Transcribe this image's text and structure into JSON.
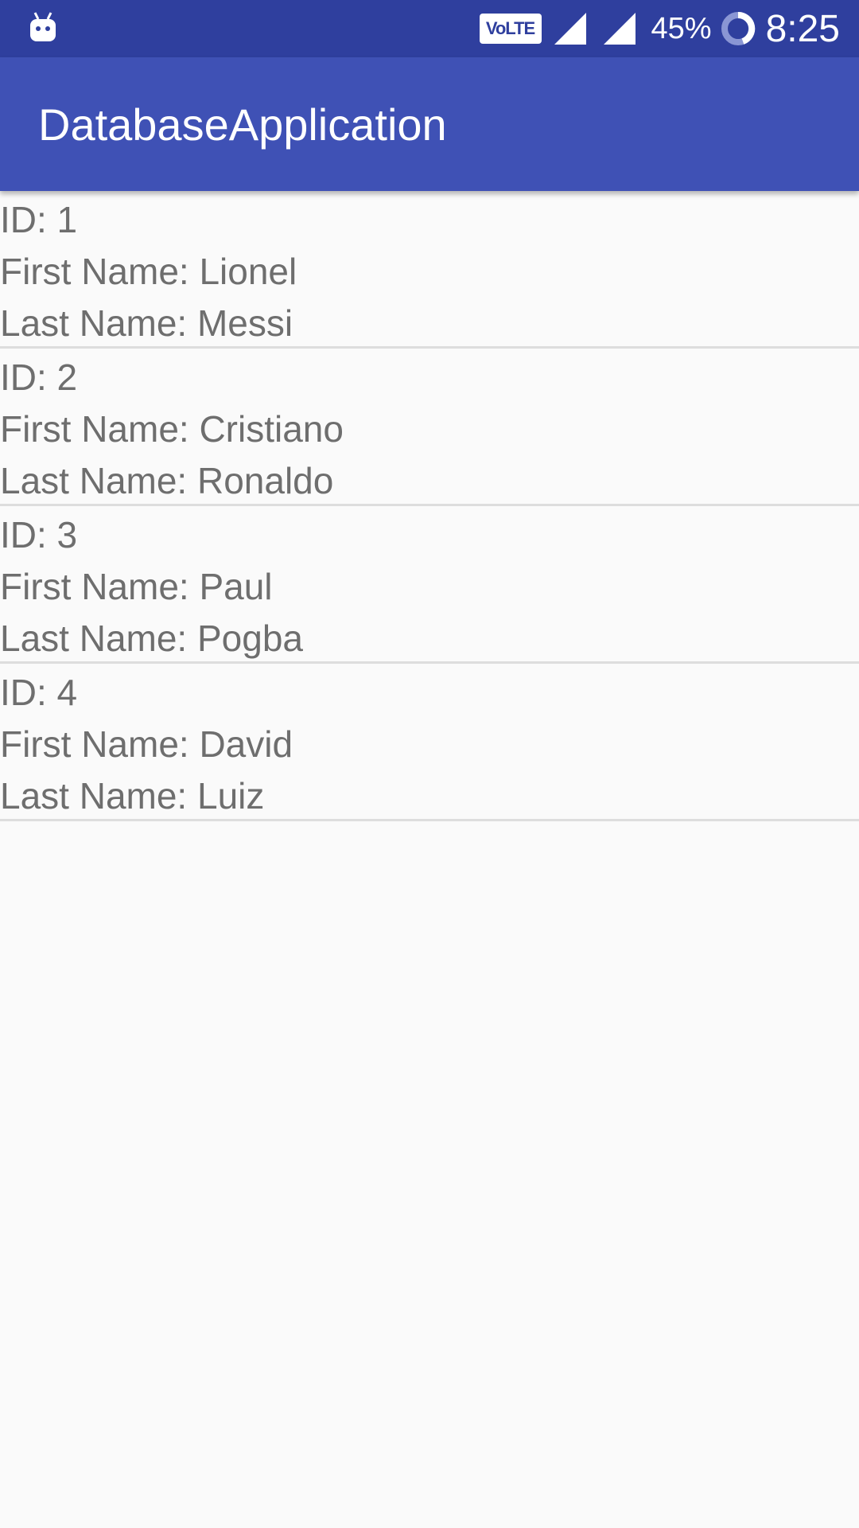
{
  "status_bar": {
    "app_icon": "android-debug-icon",
    "network_badge": "VoLTE",
    "battery_percent": "45%",
    "time": "8:25"
  },
  "app_bar": {
    "title": "DatabaseApplication"
  },
  "records": [
    {
      "id_label": "ID: 1",
      "first_name_label": "First Name: Lionel",
      "last_name_label": "Last Name: Messi"
    },
    {
      "id_label": "ID: 2",
      "first_name_label": "First Name: Cristiano",
      "last_name_label": "Last Name: Ronaldo"
    },
    {
      "id_label": "ID: 3",
      "first_name_label": "First Name: Paul",
      "last_name_label": "Last Name: Pogba"
    },
    {
      "id_label": "ID: 4",
      "first_name_label": "First Name: David",
      "last_name_label": "Last Name: Luiz"
    }
  ],
  "colors": {
    "status_bar": "#2f3f9e",
    "app_bar": "#3f51b5",
    "background": "#fafafa",
    "text": "#6e6e6e",
    "divider": "#dddddd"
  }
}
